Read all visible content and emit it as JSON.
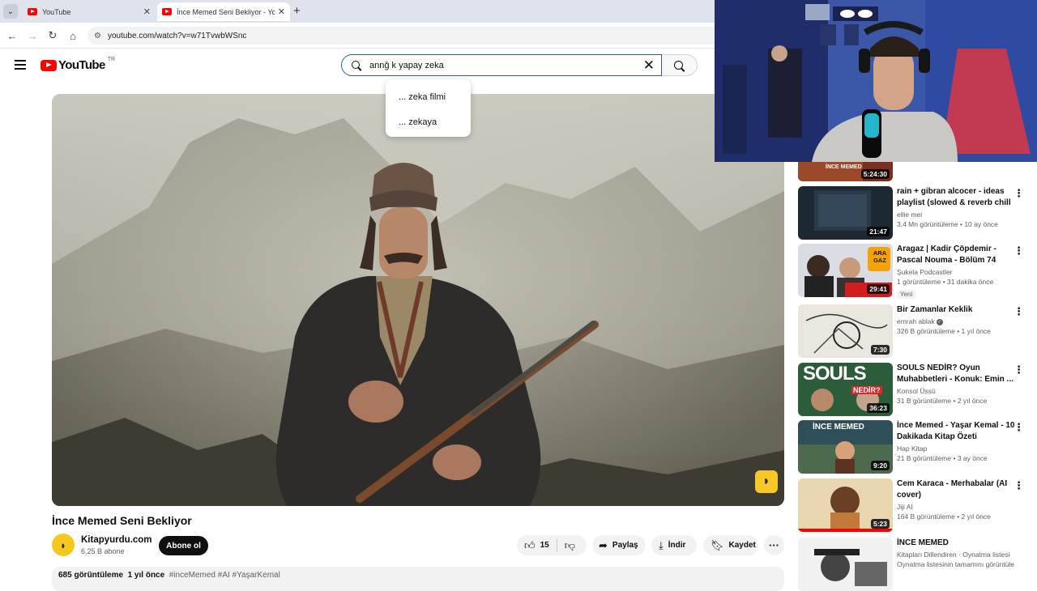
{
  "browser": {
    "tabs": [
      {
        "title": "YouTube"
      },
      {
        "title": "İnce Memed Seni Bekliyor - YouTube"
      }
    ],
    "url": "youtube.com/watch?v=w71TvwbWSnc"
  },
  "header": {
    "logo_text": "YouTube",
    "country": "TR",
    "search_query": "annǧ k yapay zeka"
  },
  "suggestions": [
    "... zeka filmi",
    "... zekaya"
  ],
  "video": {
    "title": "İnce Memed Seni Bekliyor",
    "channel": "Kitapyurdu.com",
    "subscribers": "6,25 B abone",
    "subscribe_label": "Abone ol",
    "likes": "15",
    "share_label": "Paylaş",
    "download_label": "İndir",
    "save_label": "Kaydet",
    "views": "685 görüntüleme",
    "age": "1 yıl önce",
    "hashtags": "#inceMemed #AI #YaşarKemal"
  },
  "recommendations": [
    {
      "title": "rain + gibran alcocer - ideas playlist (slowed & reverb chill pl)",
      "channel": "ellie mei",
      "views": "3,4 Mn görüntüleme",
      "age": "10 ay önce",
      "duration": "21:47"
    },
    {
      "title": "Aragaz | Kadir Çöpdemir - Pascal Nouma - Bölüm 74",
      "channel": "Şukela Podcastler",
      "views": "1 görüntüleme",
      "age": "31 dakika önce",
      "duration": "29:41",
      "badge": "Yeni"
    },
    {
      "title": "Bir Zamanlar Keklik",
      "channel": "emrah ablak",
      "views": "326 B görüntüleme",
      "age": "1 yıl önce",
      "duration": "7:30"
    },
    {
      "title": "SOULS NEDİR? Oyun Muhabbetleri - Konuk: Emin ...",
      "channel": "Konsol Üssü",
      "views": "31 B görüntüleme",
      "age": "2 yıl önce",
      "duration": "36:23"
    },
    {
      "title": "İnce Memed - Yaşar Kemal - 10 Dakikada Kitap Özeti",
      "channel": "Hap Kitap",
      "views": "21 B görüntüleme",
      "age": "3 ay önce",
      "duration": "9:20"
    },
    {
      "title": "Cem Karaca - Merhabalar (AI cover)",
      "channel": "Jiji AI",
      "views": "164 B görüntüleme",
      "age": "2 yıl önce",
      "duration": "5:23"
    },
    {
      "title": "İNCE MEMED",
      "channel": "Kitapları Dillendiren · Oynatma listesi",
      "views": "Oynatma listesinin tamamını görüntüle",
      "age": "",
      "duration": ""
    }
  ],
  "partial_top": {
    "duration": "5:24:30"
  },
  "thumb_texts": {
    "aragaz": "ARA GAZ",
    "souls": "SOULS",
    "nedir": "NEDİR?",
    "ince": "İNCE MEMED",
    "partial": "İNCE MEMED"
  },
  "colors": {
    "brand_red": "#ff0000",
    "accent_blue": "#1c62b9",
    "chip_bg": "#f2f2f2"
  }
}
